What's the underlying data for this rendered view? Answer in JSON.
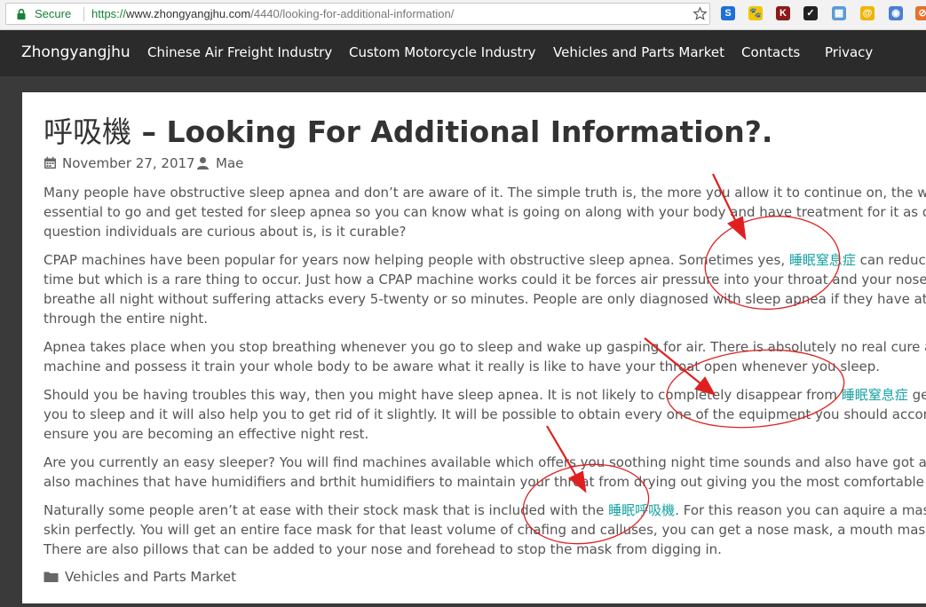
{
  "browser": {
    "secure_label": "Secure",
    "url_scheme": "https://",
    "url_host": "www.zhongyangjhu.com",
    "url_path": "/4440/looking-for-additional-information/",
    "extensions": [
      {
        "glyph": "S",
        "color": "#1e6fd9"
      },
      {
        "glyph": "🐾",
        "color": "#f5c400"
      },
      {
        "glyph": "K",
        "color": "#8b1a1a"
      },
      {
        "glyph": "✓",
        "color": "#222222"
      },
      {
        "glyph": "▦",
        "color": "#5b9bd5"
      },
      {
        "glyph": "@",
        "color": "#f0b400"
      },
      {
        "glyph": "◉",
        "color": "#4a7fd4"
      },
      {
        "glyph": "⊘",
        "color": "#e8702a"
      }
    ]
  },
  "nav": {
    "brand": "Zhongyangjhu",
    "items": [
      "Chinese Air Freight Industry",
      "Custom Motorcycle Industry",
      "Vehicles and Parts Market",
      "Contacts",
      "Privacy"
    ]
  },
  "post": {
    "title_cjk": "呼吸機",
    "title_rest": " – Looking For Additional Information?.",
    "date": "November 27, 2017",
    "author": "Mae",
    "p1": [
      "Many people have obstructive sleep apnea and don’t are aware of it. The simple truth is, the more you allow it to continue on, the worse it might g",
      "essential to go and get tested for sleep apnea so you can know what is going on along with your body and have treatment for it as quickly as possib",
      "question individuals are curious about is, is it curable?"
    ],
    "p2_l1_pre": "CPAP machines have been popular for years now helping people with obstructive sleep apnea. Sometimes yes, ",
    "p2_l1_kw": "睡眠窒息症",
    "p2_l1_post": " can reduce or cure ap",
    "p2": [
      "time but which is a rare thing to occur. Just how a CPAP machine works could it be forces air pressure into your throat and your nose so you can c",
      "breathe all night without suffering attacks every 5-twenty or so minutes. People are only diagnosed with sleep apnea if they have attacks that oft",
      "through the entire night."
    ],
    "p3": [
      "Apnea takes place when you stop breathing whenever you go to sleep and wake up gasping for air. There is absolutely no real cure apart from to u",
      "machine and possess it train your whole body to be aware what it really is like to have your throat open whenever you sleep."
    ],
    "p4_l1_pre": "Should you be having troubles this way, then you might have sleep apnea. It is not likely to completely disappear from ",
    "p4_l1_kw": "睡眠窒息症",
    "p4_l1_post": " generally but it",
    "p4": [
      "you to sleep and it will also help you to get rid of it slightly. It will be possible to obtain every one of the equipment you should accompany your m",
      "ensure you are becoming an effective night rest."
    ],
    "p5": [
      "Are you currently an easy sleeper? You will find machines available which offers you soothing night time sounds and also have got a quiet motor. T",
      "also machines that have humidifiers and brthit humidifiers to maintain your throat from drying out giving you the most comfortable sleep you can"
    ],
    "p6_l1_pre": "Naturally some people aren’t at ease with their stock mask that is included with the ",
    "p6_l1_kw": "睡眠呼吸機",
    "p6_l1_post": ". For this reason you can aquire a mask that suits y",
    "p6": [
      "skin perfectly. You will get an entire face mask for that least volume of chafing and calluses, you can get a nose mask, a mouth mask or different w",
      "There are also pillows that can be added to your nose and forehead to stop the mask from digging in."
    ],
    "category": "Vehicles and Parts Market"
  },
  "colors": {
    "navbar": "#2b2b2b",
    "keyword_link": "#17a2a2",
    "annotation": "#e02020"
  }
}
